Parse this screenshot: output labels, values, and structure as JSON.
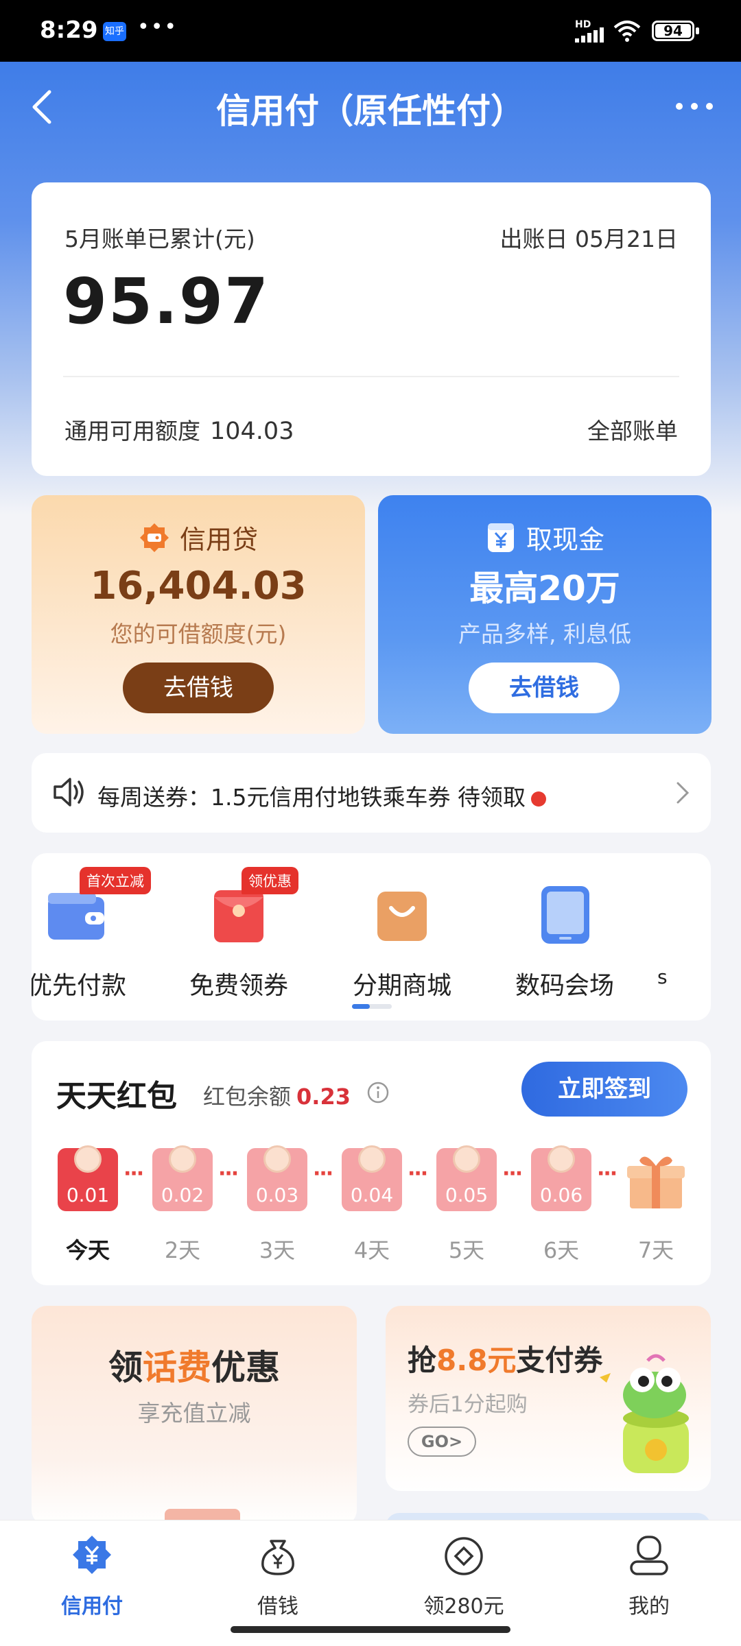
{
  "status_bar": {
    "time": "8:29",
    "app_badge": "知乎",
    "more": "•••",
    "signal": "HD",
    "battery": "94"
  },
  "header": {
    "title": "信用付（原任性付）"
  },
  "bill": {
    "label": "5月账单已累计(元)",
    "due_label": "出账日 05月21日",
    "amount": "95.97",
    "limit_label": "通用可用额度",
    "limit_value": "104.03",
    "all_bills": "全部账单"
  },
  "loan_card": {
    "title": "信用贷",
    "amount": "16,404.03",
    "subtitle": "您的可借额度(元)",
    "button": "去借钱"
  },
  "cash_card": {
    "title": "取现金",
    "headline": "最高20万",
    "subtitle": "产品多样, 利息低",
    "button": "去借钱"
  },
  "notice": {
    "text": "每周送券：1.5元信用付地铁乘车券 待领取"
  },
  "quick_icons": [
    {
      "label": "优先付款",
      "tag": "首次立减",
      "icon": "wallet-icon"
    },
    {
      "label": "免费领券",
      "tag": "领优惠",
      "icon": "red-envelope-icon"
    },
    {
      "label": "分期商城",
      "tag": "",
      "icon": "shopping-bag-icon"
    },
    {
      "label": "数码会场",
      "tag": "",
      "icon": "tablet-icon"
    },
    {
      "label": "s",
      "tag": "",
      "icon": ""
    }
  ],
  "red_packet": {
    "title": "天天红包",
    "balance_label": "红包余额",
    "balance_value": "0.23",
    "sign_button": "立即签到",
    "days": [
      {
        "value": "0.01",
        "label": "今天"
      },
      {
        "value": "0.02",
        "label": "2天"
      },
      {
        "value": "0.03",
        "label": "3天"
      },
      {
        "value": "0.04",
        "label": "4天"
      },
      {
        "value": "0.05",
        "label": "5天"
      },
      {
        "value": "0.06",
        "label": "6天"
      },
      {
        "value": "",
        "label": "7天"
      }
    ],
    "dots": "···"
  },
  "promo_phone": {
    "title_pre": "领",
    "title_hl": "话费",
    "title_post": "优惠",
    "subtitle": "享充值立减"
  },
  "promo_pay": {
    "title_pre": "抢",
    "title_hl": "8.8元",
    "title_post": "支付券",
    "subtitle": "券后1分起购",
    "go": "GO>"
  },
  "tabs": [
    {
      "label": "信用付",
      "icon": "credit-pay-icon"
    },
    {
      "label": "借钱",
      "icon": "money-bag-icon"
    },
    {
      "label": "领280元",
      "icon": "coin-diamond-icon"
    },
    {
      "label": "我的",
      "icon": "profile-icon"
    }
  ],
  "colors": {
    "primary": "#3a78e6",
    "loan_brown": "#7a3e16",
    "red": "#e5322c",
    "orange": "#f07a2c"
  }
}
